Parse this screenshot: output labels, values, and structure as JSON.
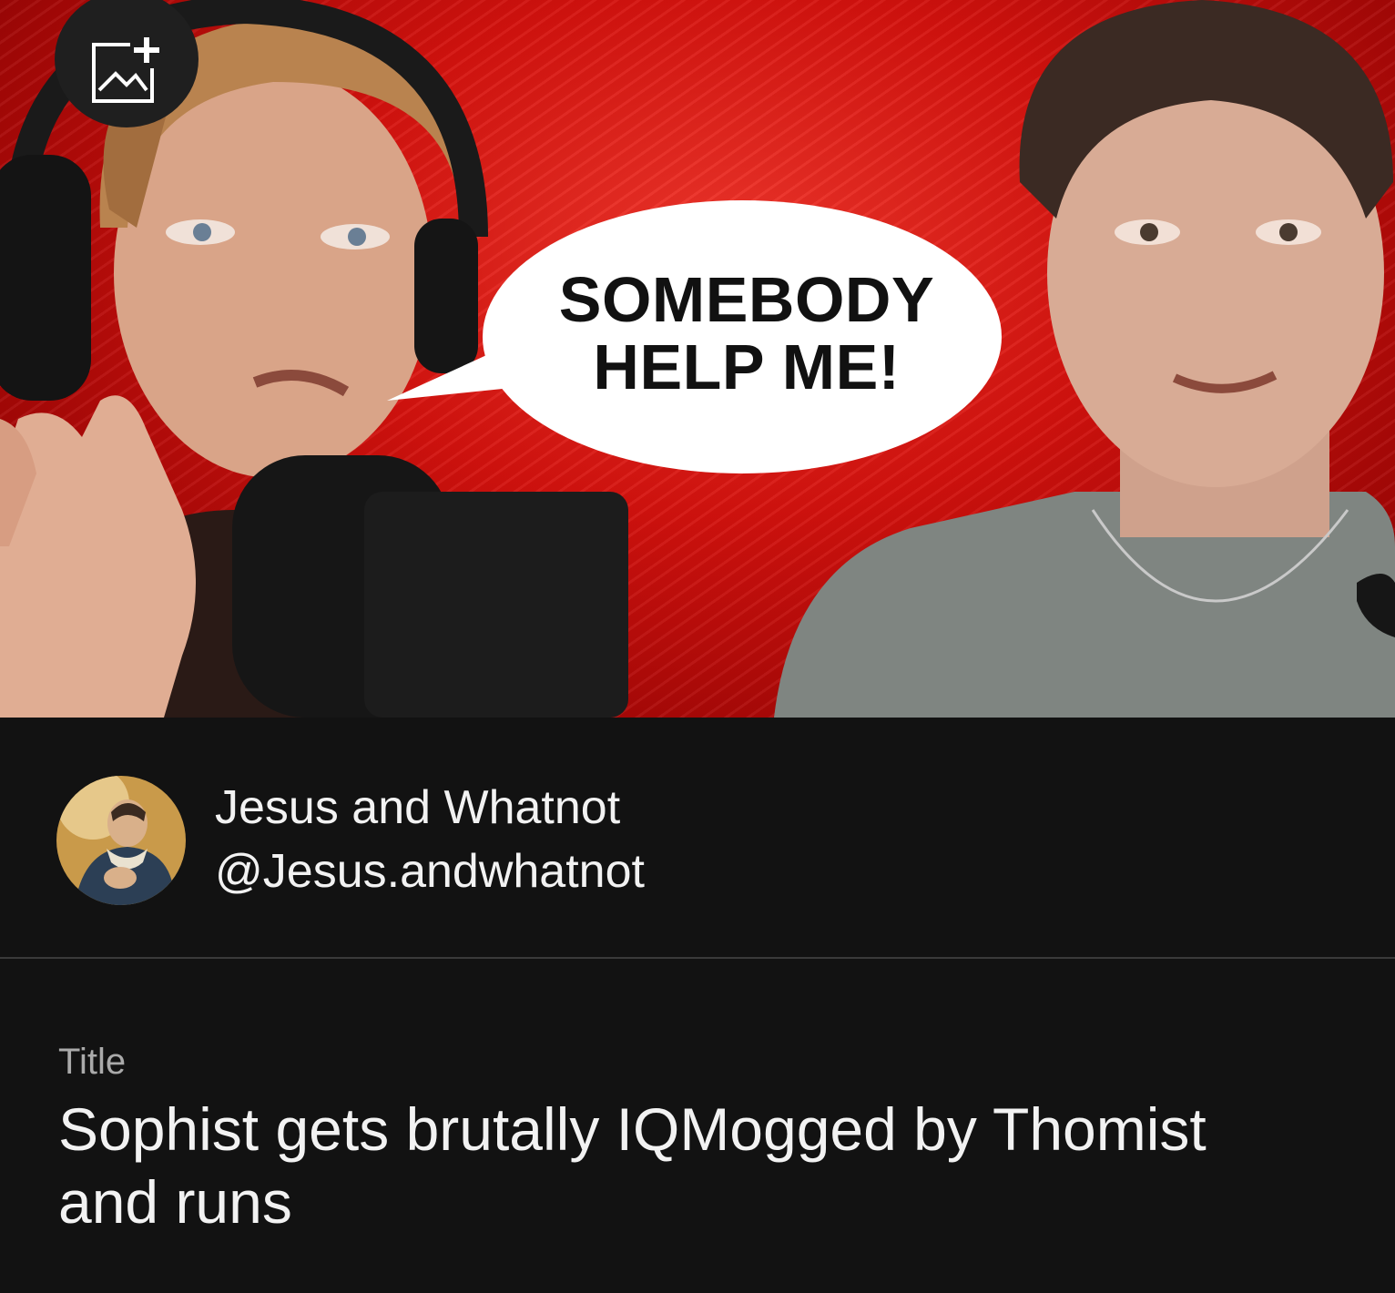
{
  "thumbnail": {
    "add_thumbnail_icon": "add-image-icon",
    "speech_bubble": {
      "line1": "SOMEBODY",
      "line2": "HELP ME!"
    },
    "colors": {
      "background": "#d4120e",
      "bubble": "#ffffff"
    }
  },
  "channel": {
    "name": "Jesus and Whatnot",
    "handle": "@Jesus.andwhatnot"
  },
  "video": {
    "title_label": "Title",
    "title": "Sophist gets brutally IQMogged by Thomist and runs"
  },
  "colors": {
    "page_bg": "#121212",
    "text": "#f2f2f2",
    "muted": "#aaaaaa"
  }
}
